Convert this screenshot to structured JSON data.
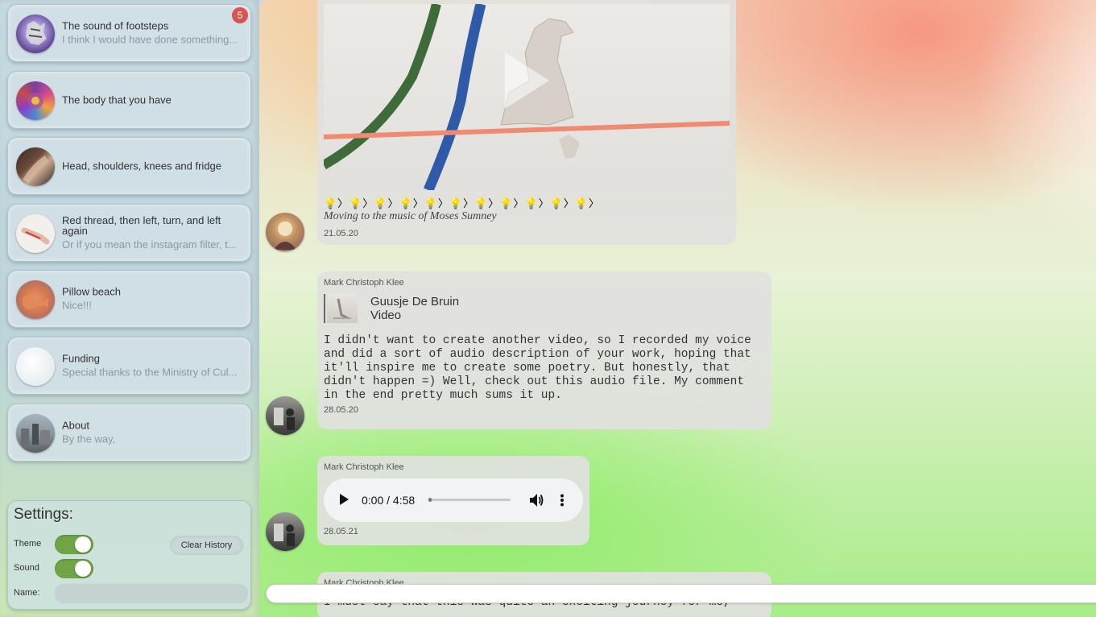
{
  "sidebar": {
    "chats": [
      {
        "title": "The sound of footsteps",
        "subtitle": "I think I would have done something...",
        "badge": "5"
      },
      {
        "title": "The body that you have",
        "subtitle": ""
      },
      {
        "title": "Head, shoulders, knees and fridge",
        "subtitle": ""
      },
      {
        "title": "Red thread, then left, turn, and left again",
        "subtitle": "Or if you mean the instagram filter, t..."
      },
      {
        "title": "Pillow beach",
        "subtitle": "Nice!!!"
      },
      {
        "title": "Funding",
        "subtitle": "Special thanks to the Ministry of Cul..."
      },
      {
        "title": "About",
        "subtitle": "By the way,"
      }
    ]
  },
  "settings": {
    "title": "Settings:",
    "theme_label": "Theme",
    "sound_label": "Sound",
    "name_label": "Name:",
    "clear_history_label": "Clear History",
    "theme_on": true,
    "sound_on": true
  },
  "messages": [
    {
      "emoji_row": "💡〉💡〉💡〉💡〉💡〉💡〉💡〉💡〉💡〉💡〉💡〉",
      "caption": "Moving to the music of Moses Sumney",
      "date": "21.05.20"
    },
    {
      "sender": "Mark Christoph Klee",
      "reply_to_name": "Guusje De Bruin",
      "reply_to_type": "Video",
      "text": "I didn't want to create another video, so I recorded my voice and did a sort of audio description of your work, hoping that it'll inspire me to create some poetry. But honestly, that didn't happen =) Well, check out this audio file. My comment in the end pretty much sums it up.",
      "date": "28.05.20"
    },
    {
      "sender": "Mark Christoph Klee",
      "audio_time": "0:00 / 4:58",
      "audio_progress": 0,
      "date": "28.05.21"
    },
    {
      "sender": "Mark Christoph Klee",
      "text": "I must say that this was quite an exciting journey for me,"
    }
  ],
  "colors": {
    "toggle_on": "#6fa545",
    "badge": "#d9534f"
  }
}
